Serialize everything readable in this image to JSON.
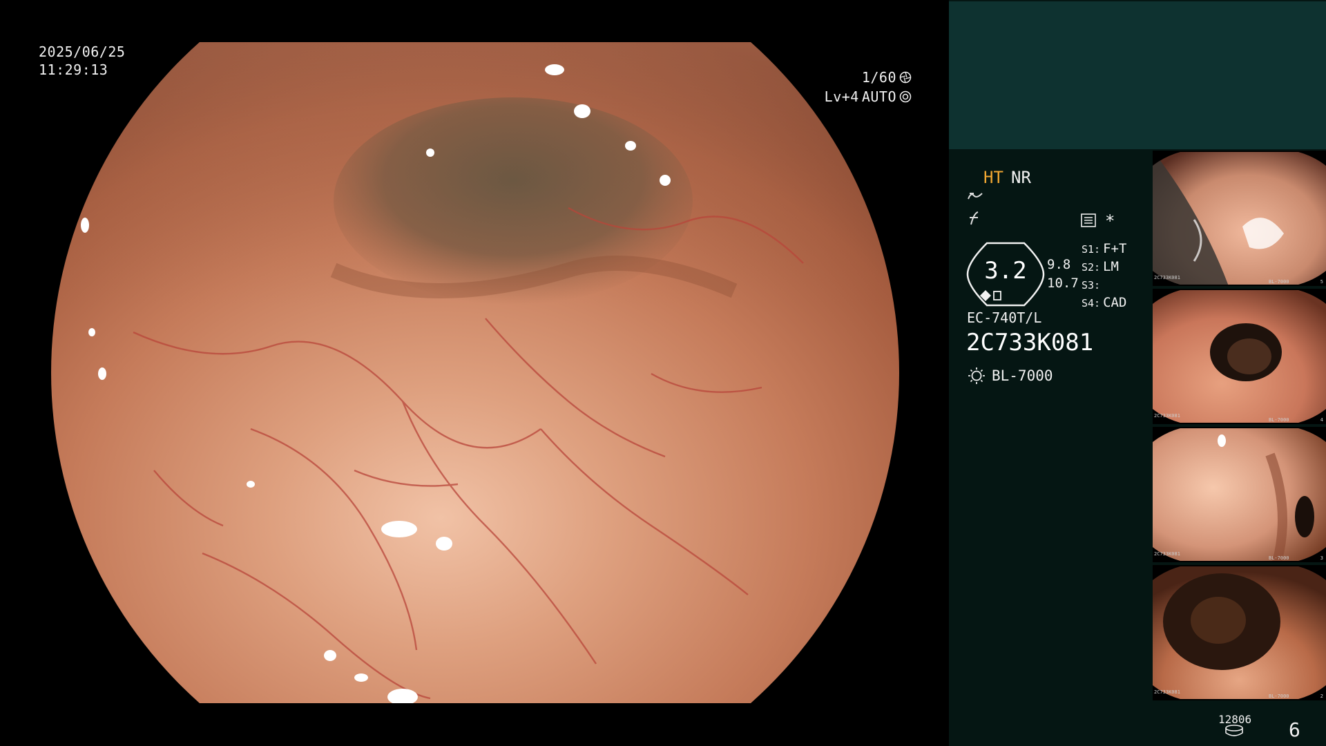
{
  "overlay": {
    "date": "2025/06/25",
    "time": "11:29:13",
    "shutter": "1/60",
    "level": "Lv+4",
    "iris_mode": "AUTO"
  },
  "panel": {
    "ht_label": "HT",
    "nr_label": "NR",
    "enhancement_value": "3.2",
    "side_values": [
      "9.8",
      "10.7"
    ],
    "switches": [
      {
        "key": "S1:",
        "value": "F+T"
      },
      {
        "key": "S2:",
        "value": "LM"
      },
      {
        "key": "S3:",
        "value": ""
      },
      {
        "key": "S4:",
        "value": "CAD"
      }
    ],
    "star": "*",
    "scope_model": "EC-740T/L",
    "scope_serial": "2C733K081",
    "light_source": "BL-7000",
    "record_count": "12806",
    "page_number": "6"
  },
  "thumbnails": [
    {
      "serial": "2C733K081",
      "light": "BL-7000",
      "index": "5",
      "tone": "#c98a6e"
    },
    {
      "serial": "2C733K081",
      "light": "BL-7000",
      "index": "4",
      "tone": "#c9765a"
    },
    {
      "serial": "2C733K081",
      "light": "BL-7000",
      "index": "3",
      "tone": "#d49478"
    },
    {
      "serial": "2C733K081",
      "light": "BL-7000",
      "index": "2",
      "tone": "#b86a48"
    }
  ],
  "icons": {
    "shutter": "aperture-icon",
    "iris": "iris-icon",
    "wave": "wave-icon",
    "freq": "frequency-icon",
    "memory": "memory-icon",
    "light": "light-bulb-icon",
    "storage": "storage-disk-icon"
  },
  "colors": {
    "panel_bg": "#051613",
    "panel_top": "#0e3230",
    "ht_accent": "#f1a732",
    "mucosa": "#c07a5a"
  }
}
